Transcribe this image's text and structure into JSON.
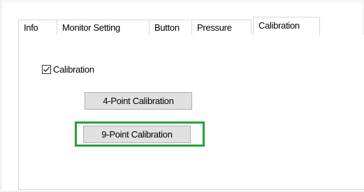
{
  "tabs": [
    {
      "label": "Info",
      "selected": false
    },
    {
      "label": "Monitor Setting",
      "selected": false
    },
    {
      "label": "Button",
      "selected": false
    },
    {
      "label": "Pressure",
      "selected": false
    },
    {
      "label": "Calibration",
      "selected": true
    }
  ],
  "calibration": {
    "checkbox_label": "Calibration",
    "checkbox_checked": true,
    "button_4_point": "4-Point Calibration",
    "button_9_point": "9-Point Calibration"
  },
  "colors": {
    "highlight": "#22a33a",
    "tab_border": "#d9d9d9",
    "button_bg": "#e1e1e1",
    "button_border": "#adadad"
  },
  "icons": {
    "checkbox_check": "check-icon"
  }
}
